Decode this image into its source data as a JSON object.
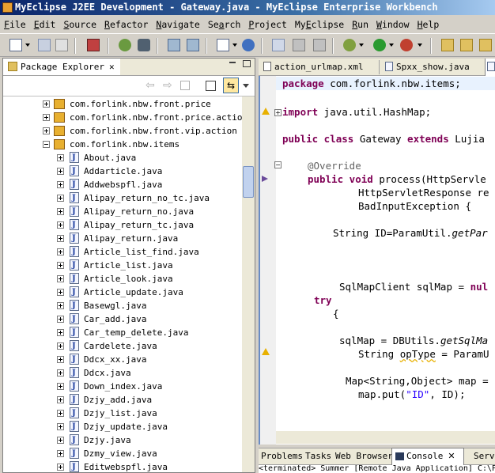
{
  "window": {
    "title": "MyEclipse J2EE Development - Gateway.java - MyEclipse Enterprise Workbench"
  },
  "menu": [
    {
      "label": "File",
      "u": "F",
      "rest": "ile"
    },
    {
      "label": "Edit",
      "u": "E",
      "rest": "dit"
    },
    {
      "label": "Source",
      "u": "S",
      "rest": "ource"
    },
    {
      "label": "Refactor",
      "u": "R",
      "rest": "efactor"
    },
    {
      "label": "Navigate",
      "u": "N",
      "rest": "avigate"
    },
    {
      "label": "Search",
      "u": "S",
      "rest": "earch",
      "pre": "Se",
      "post": "rch",
      "mid": "a"
    },
    {
      "label": "Project",
      "u": "P",
      "rest": "roject"
    },
    {
      "label": "MyEclipse",
      "u": "M",
      "rest": "yEclipse",
      "pre": "My",
      "mid": "E",
      "post": "clipse"
    },
    {
      "label": "Run",
      "u": "R",
      "rest": "un"
    },
    {
      "label": "Window",
      "u": "W",
      "rest": "indow"
    },
    {
      "label": "Help",
      "u": "H",
      "rest": "elp"
    }
  ],
  "package_explorer": {
    "tab_label": "Package Explorer",
    "packages": [
      {
        "label": "com.forlink.nbw.front.price",
        "expanded": false
      },
      {
        "label": "com.forlink.nbw.front.price.action",
        "expanded": false
      },
      {
        "label": "com.forlink.nbw.front.vip.action",
        "expanded": false
      },
      {
        "label": "com.forlink.nbw.items",
        "expanded": true
      }
    ],
    "files": [
      "About.java",
      "Addarticle.java",
      "Addwebspfl.java",
      "Alipay_return_no_tc.java",
      "Alipay_return_no.java",
      "Alipay_return_tc.java",
      "Alipay_return.java",
      "Article_list_find.java",
      "Article_list.java",
      "Article_look.java",
      "Article_update.java",
      "Basewgl.java",
      "Car_add.java",
      "Car_temp_delete.java",
      "Cardelete.java",
      "Ddcx_xx.java",
      "Ddcx.java",
      "Down_index.java",
      "Dzjy_add.java",
      "Dzjy_list.java",
      "Dzjy_update.java",
      "Dzjy.java",
      "Dzmy_view.java",
      "Editwebspfl.java"
    ]
  },
  "editor": {
    "tabs": [
      {
        "label": "action_urlmap.xml",
        "active": false
      },
      {
        "label": "Spxx_show.java",
        "active": false
      }
    ],
    "lines": {
      "l1_kw": "package",
      "l1_rest": " com.forlink.nbw.items;",
      "l2_kw": "import",
      "l2_rest": " java.util.HashMap;",
      "l3_kw1": "public class",
      "l3_mid": " Gateway ",
      "l3_kw2": "extends",
      "l3_rest": " Lujia",
      "l4_ann": "@Override",
      "l5_kw": "public void",
      "l5_rest": " process(HttpServle",
      "l6": "HttpServletResponse re",
      "l7": "BadInputException {",
      "l8_pre": "String ID=ParamUtil.",
      "l8_it": "getPar",
      "l9_pre": "SqlMapClient sqlMap = ",
      "l9_kw": "nul",
      "l10_kw": "try",
      "l11": "{",
      "l12_pre": "sqlMap = DBUtils.",
      "l12_it": "getSqlMa",
      "l13_pre": "String ",
      "l13_u": "opType",
      "l13_rest": " = ParamU",
      "l14": "Map<String,Object> map =",
      "l15_pre": "map.put(",
      "l15_str": "\"ID\"",
      "l15_rest": ", ID);"
    }
  },
  "bottom_tabs": [
    {
      "label": "Problems"
    },
    {
      "label": "Tasks"
    },
    {
      "label": "Web Browser"
    },
    {
      "label": "Console"
    },
    {
      "label": "Serv"
    }
  ],
  "console": {
    "text": "<terminated> Summer [Remote Java Application] C:\\Program"
  }
}
